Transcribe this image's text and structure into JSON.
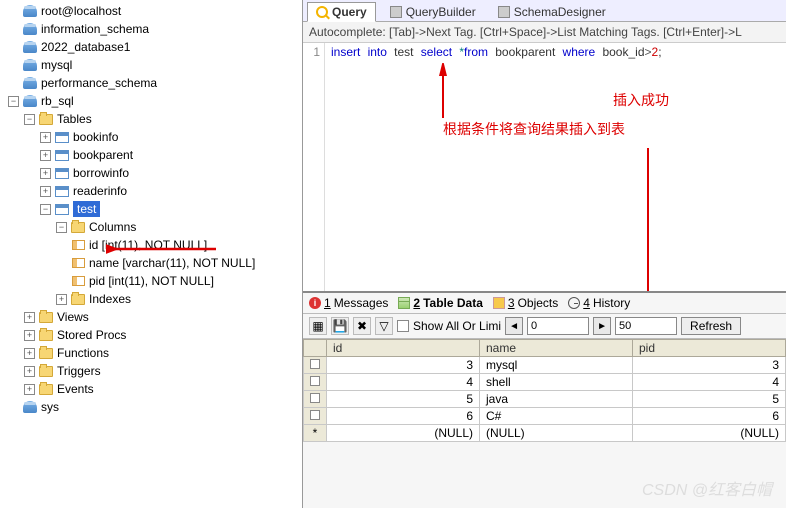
{
  "connection": "root@localhost",
  "databases": [
    "information_schema",
    "2022_database1",
    "mysql",
    "performance_schema"
  ],
  "current_db": "rb_sql",
  "folders": {
    "tables": "Tables",
    "columns": "Columns",
    "indexes": "Indexes",
    "views": "Views",
    "stored": "Stored Procs",
    "functions": "Functions",
    "triggers": "Triggers",
    "events": "Events"
  },
  "tables": [
    "bookinfo",
    "bookparent",
    "borrowinfo",
    "readerinfo",
    "test"
  ],
  "selected_table": "test",
  "columns": [
    "id [int(11), NOT NULL]",
    "name [varchar(11), NOT NULL]",
    "pid [int(11), NOT NULL]"
  ],
  "other_db": "sys",
  "tabs": {
    "query": "Query",
    "qb": "QueryBuilder",
    "sd": "SchemaDesigner"
  },
  "autocomplete": "Autocomplete: [Tab]->Next Tag. [Ctrl+Space]->List Matching Tags. [Ctrl+Enter]->L",
  "line_no": "1",
  "sql": {
    "insert": "insert",
    "into": "into",
    "test": "test",
    "select": "select",
    "star": "*",
    "from": "from",
    "bookparent": "bookparent",
    "where": "where",
    "book_id": "book_id",
    "gt": ">",
    "val": "2",
    ";": ";"
  },
  "anno1": "根据条件将查询结果插入到表",
  "anno2": "插入成功",
  "result_tabs": {
    "messages": "Messages",
    "tabledata": "Table Data",
    "objects": "Objects",
    "history": "History",
    "n1": "1",
    "n2": "2",
    "n3": "3",
    "n4": "4"
  },
  "toolbar": {
    "show_all": "Show All Or Limi",
    "page_start": "0",
    "page_size": "50",
    "refresh": "Refresh"
  },
  "grid": {
    "headers": [
      "id",
      "name",
      "pid"
    ],
    "rows": [
      {
        "id": "3",
        "name": "mysql",
        "pid": "3"
      },
      {
        "id": "4",
        "name": "shell",
        "pid": "4"
      },
      {
        "id": "5",
        "name": "java",
        "pid": "5"
      },
      {
        "id": "6",
        "name": "C#",
        "pid": "6"
      }
    ],
    "nullrow": {
      "star": "*",
      "null": "(NULL)"
    }
  },
  "watermark": "CSDN @红客白帽"
}
